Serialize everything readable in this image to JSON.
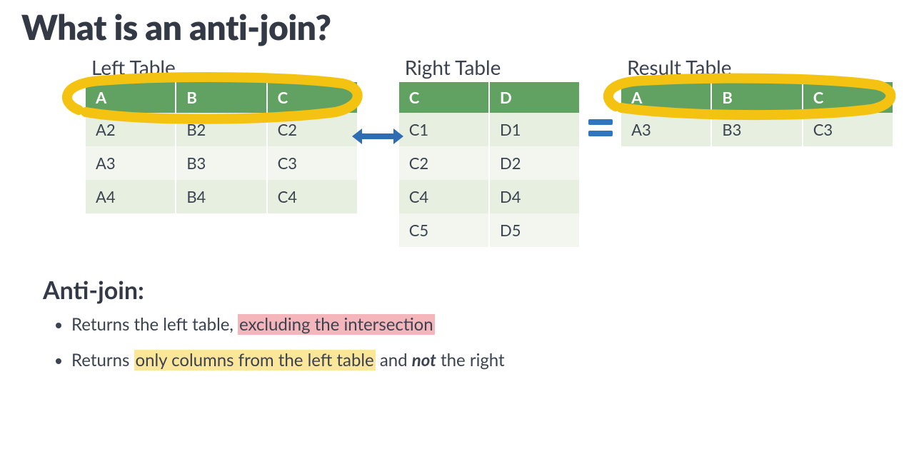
{
  "title": "What is an anti-join?",
  "tables": {
    "left": {
      "caption": "Left Table",
      "headers": [
        "A",
        "B",
        "C"
      ],
      "rows": [
        [
          "A2",
          "B2",
          "C2"
        ],
        [
          "A3",
          "B3",
          "C3"
        ],
        [
          "A4",
          "B4",
          "C4"
        ]
      ]
    },
    "right": {
      "caption": "Right Table",
      "headers": [
        "C",
        "D"
      ],
      "rows": [
        [
          "C1",
          "D1"
        ],
        [
          "C2",
          "D2"
        ],
        [
          "C4",
          "D4"
        ],
        [
          "C5",
          "D5"
        ]
      ]
    },
    "result": {
      "caption": "Result Table",
      "headers": [
        "A",
        "B",
        "C"
      ],
      "rows": [
        [
          "A3",
          "B3",
          "C3"
        ]
      ]
    }
  },
  "notes": {
    "heading": "Anti-join:",
    "bullets": [
      {
        "pre": "Returns the left table, ",
        "hl": "excluding the intersection",
        "hl_class": "hl-pink",
        "post": ""
      },
      {
        "pre": "Returns ",
        "hl": "only columns from the left table",
        "hl_class": "hl-yellow",
        "post_pre": " and ",
        "em": "not",
        "post": " the right"
      }
    ]
  },
  "colors": {
    "header_bg": "#61a161",
    "row_odd": "#e7efe1",
    "row_even": "#f2f6ef",
    "scribble": "#f4c312",
    "arrow": "#2e6db4",
    "equals": "#2e76bf",
    "hl_pink": "#f4b6bb",
    "hl_yellow": "#fbe69a"
  }
}
